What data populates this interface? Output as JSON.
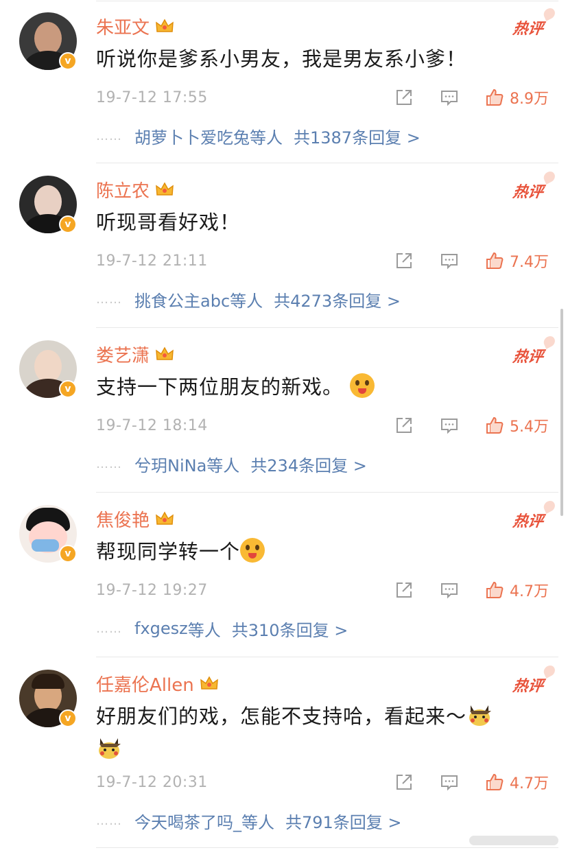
{
  "comments": [
    {
      "username": "朱亚文",
      "hot_label": "热评",
      "text": "听说你是爹系小男友，我是男友系小爹！",
      "time": "19-7-12 17:55",
      "likes": "8.9万",
      "reply_names": "胡萝卜卜爱吃兔",
      "reply_suffix": "等人",
      "reply_total": "共1387条回复 >"
    },
    {
      "username": "陈立农",
      "hot_label": "热评",
      "text": "听现哥看好戏！",
      "time": "19-7-12 21:11",
      "likes": "7.4万",
      "reply_names": "挑食公主abc",
      "reply_suffix": "等人",
      "reply_total": "共4273条回复 >"
    },
    {
      "username": "娄艺潇",
      "hot_label": "热评",
      "text": "支持一下两位朋友的新戏。",
      "time": "19-7-12 18:14",
      "likes": "5.4万",
      "reply_names": "兮玥NiNa",
      "reply_suffix": "等人",
      "reply_total": "共234条回复 >"
    },
    {
      "username": "焦俊艳",
      "hot_label": "热评",
      "text": "帮现同学转一个",
      "time": "19-7-12 19:27",
      "likes": "4.7万",
      "reply_names": "fxgesz",
      "reply_suffix": "等人",
      "reply_total": "共310条回复 >"
    },
    {
      "username": "任嘉伦Allen",
      "hot_label": "热评",
      "text": "好朋友们的戏，怎能不支持哈，看起来～",
      "time": "19-7-12 20:31",
      "likes": "4.7万",
      "reply_names": "今天喝茶了吗_",
      "reply_suffix": "等人",
      "reply_total": "共791条回复 >"
    }
  ],
  "icons": {
    "verified": "verified-v-icon",
    "crown": "crown-icon",
    "share": "share-icon",
    "comment": "comment-icon",
    "like": "thumbs-up-icon"
  },
  "colors": {
    "accent": "#eb7350",
    "link": "#5b7fb0",
    "meta": "#b2b2b2",
    "hot": "#e8523a"
  }
}
